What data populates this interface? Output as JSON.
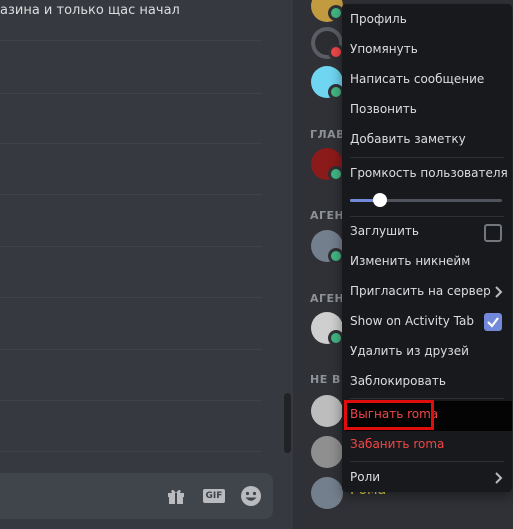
{
  "chat": {
    "top_message": "азина и только щас начал"
  },
  "chatbox": {
    "gift_icon": "gift-icon",
    "gif_label": "GIF",
    "emoji_icon": "emoji-icon"
  },
  "members": {
    "categories": [
      "ГЛАВ",
      "АГЕН",
      "АГЕН",
      "НЕ В"
    ],
    "visible_member_name": "Рома",
    "status_color": "#43b581",
    "name_color": "#f0e04e"
  },
  "context_menu": {
    "profile": "Профиль",
    "mention": "Упомянуть",
    "message": "Написать сообщение",
    "call": "Позвонить",
    "add_note": "Добавить заметку",
    "user_volume": "Громкость пользователя",
    "user_volume_level": 0.2,
    "mute": "Заглушить",
    "mute_checked": false,
    "change_nickname": "Изменить никнейм",
    "invite_to_server": "Пригласить на сервер",
    "show_on_activity_tab": "Show on Activity Tab",
    "show_on_activity_checked": true,
    "remove_friend": "Удалить из друзей",
    "block": "Заблокировать",
    "kick": "Выгнать roma",
    "ban": "Забанить roma",
    "roles": "Роли",
    "accent_color": "#7289da",
    "danger_color": "#f04747",
    "highlight_color": "#e10d0d"
  }
}
